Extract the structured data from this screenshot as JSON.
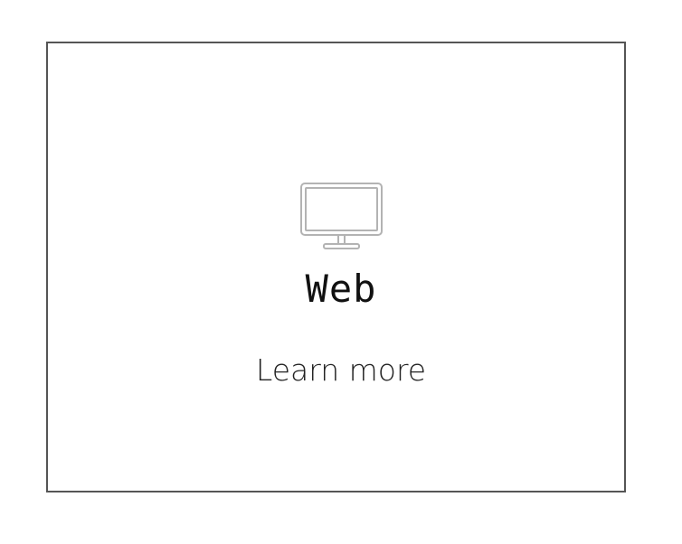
{
  "card": {
    "icon": "desktop-monitor-icon",
    "title": "Web",
    "link_label": "Learn more"
  },
  "colors": {
    "border": "#555555",
    "icon_stroke": "#b3b3b3",
    "text": "#111111"
  }
}
